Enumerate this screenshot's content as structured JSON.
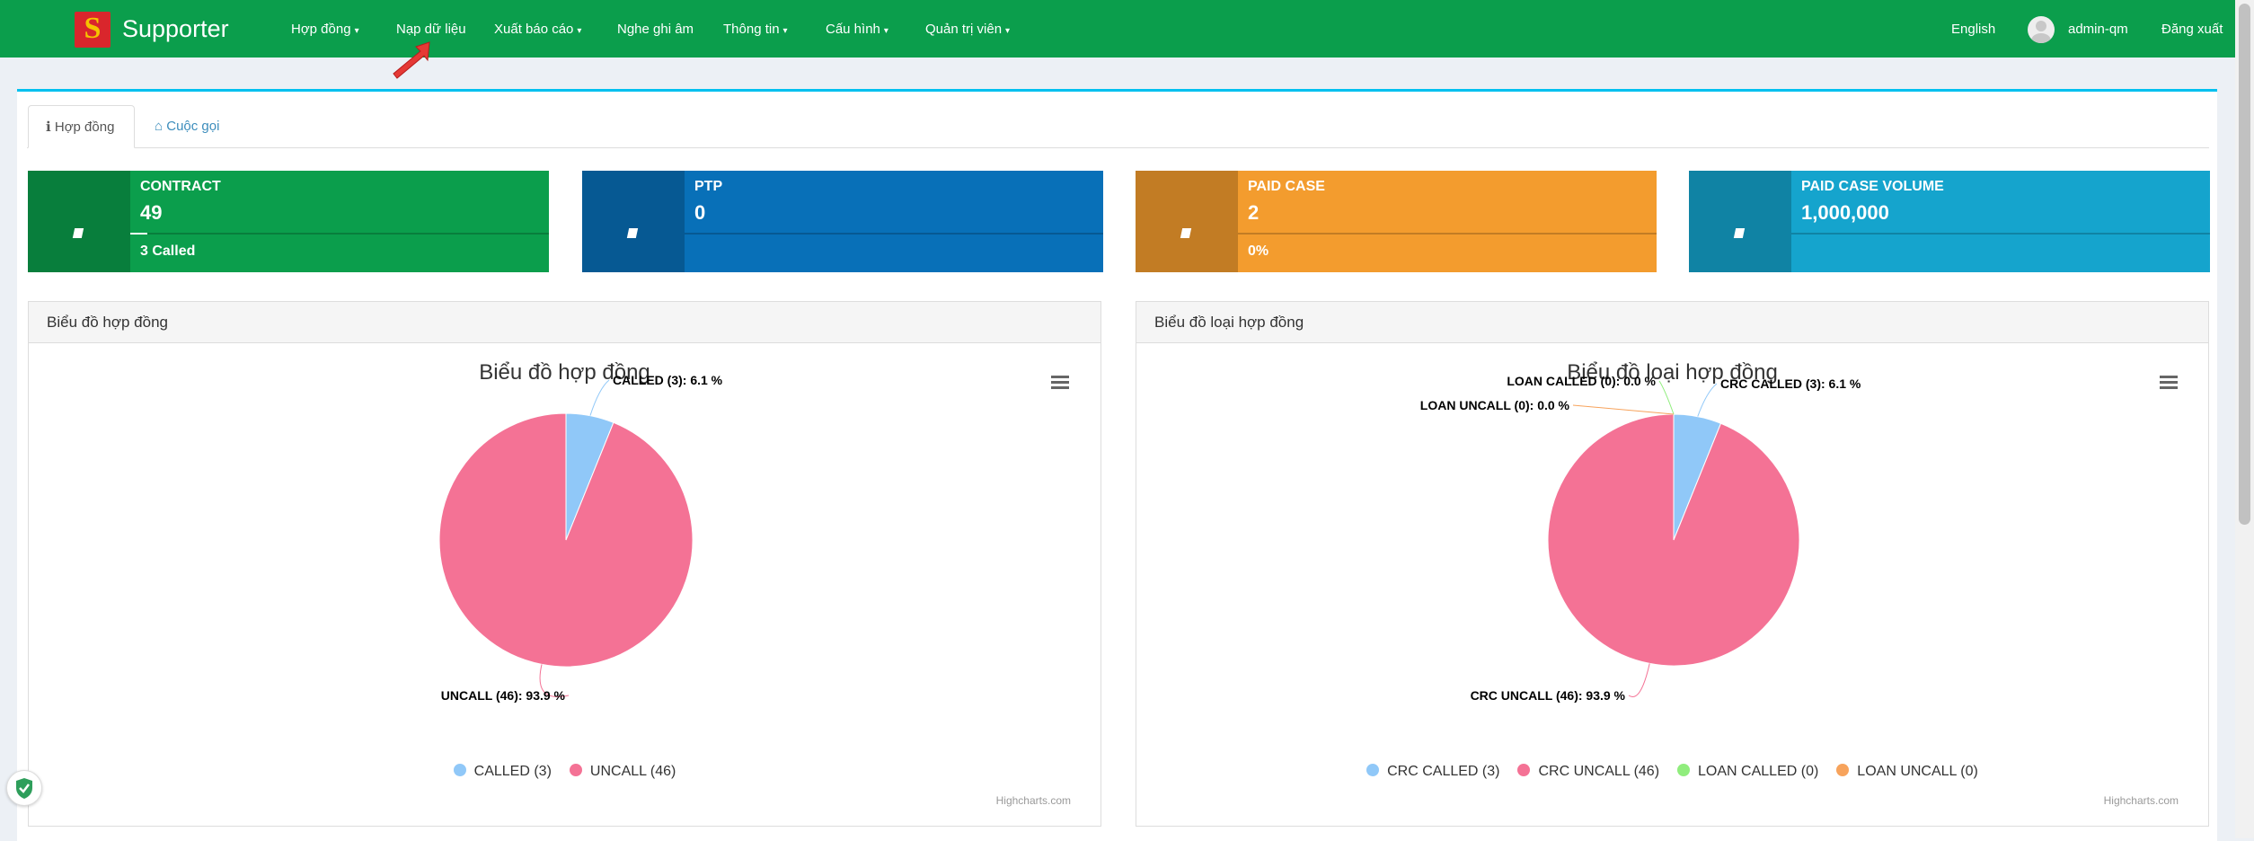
{
  "navbar": {
    "brand": "Supporter",
    "logo_letter": "S",
    "menu": [
      {
        "label": "Hợp đồng",
        "dropdown": true
      },
      {
        "label": "Nạp dữ liệu",
        "dropdown": false
      },
      {
        "label": "Xuất báo cáo",
        "dropdown": true
      },
      {
        "label": "Nghe ghi âm",
        "dropdown": false
      },
      {
        "label": "Thông tin",
        "dropdown": true
      },
      {
        "label": "Cấu hình",
        "dropdown": true
      },
      {
        "label": "Quản trị viên",
        "dropdown": true
      }
    ],
    "caret": "▾",
    "language": "English",
    "user": "admin-qm",
    "logout": "Đăng xuất"
  },
  "tabs": [
    {
      "label": "Hợp đồng",
      "icon": "info-circle-icon",
      "glyph": "ℹ",
      "active": true
    },
    {
      "label": "Cuộc gọi",
      "icon": "home-icon",
      "glyph": "⌂",
      "active": false
    }
  ],
  "info_boxes": [
    {
      "label": "CONTRACT",
      "number": "49",
      "progress": 0.04,
      "desc": "3 Called",
      "color": "#0b9e4c"
    },
    {
      "label": "PTP",
      "number": "0",
      "progress": 0,
      "desc": "",
      "color": "#0870b8"
    },
    {
      "label": "PAID CASE",
      "number": "2",
      "progress": 0,
      "desc": "0%",
      "color": "#f39c2e"
    },
    {
      "label": "PAID CASE VOLUME",
      "number": "1,000,000",
      "progress": 0,
      "desc": "",
      "color": "#15a4cd"
    }
  ],
  "panels": [
    {
      "heading": "Biểu đồ hợp đồng",
      "credits": "Highcharts.com"
    },
    {
      "heading": "Biểu đồ loại hợp đồng",
      "credits": "Highcharts.com"
    }
  ],
  "chart_data": [
    {
      "type": "pie",
      "title": "Biểu đồ hợp đồng",
      "series": [
        {
          "values": [
            {
              "name": "CALLED",
              "count": 3,
              "percent": 6.1,
              "label": "CALLED (3): 6.1 %",
              "legend": "CALLED (3)",
              "color": "#90c8f8"
            },
            {
              "name": "UNCALL",
              "count": 46,
              "percent": 93.9,
              "label": "UNCALL (46): 93.9 %",
              "legend": "UNCALL (46)",
              "color": "#f47295"
            }
          ]
        }
      ],
      "legend_position": "bottom-center"
    },
    {
      "type": "pie",
      "title": "Biểu đồ loại hợp đồng",
      "series": [
        {
          "values": [
            {
              "name": "CRC CALLED",
              "count": 3,
              "percent": 6.1,
              "label": "CRC CALLED (3): 6.1 %",
              "legend": "CRC CALLED (3)",
              "color": "#90c8f8"
            },
            {
              "name": "CRC UNCALL",
              "count": 46,
              "percent": 93.9,
              "label": "CRC UNCALL (46): 93.9 %",
              "legend": "CRC UNCALL (46)",
              "color": "#f47295"
            },
            {
              "name": "LOAN CALLED",
              "count": 0,
              "percent": 0.0,
              "label": "LOAN CALLED (0): 0.0 %",
              "legend": "LOAN CALLED (0)",
              "color": "#90ed7d"
            },
            {
              "name": "LOAN UNCALL",
              "count": 0,
              "percent": 0.0,
              "label": "LOAN UNCALL (0): 0.0 %",
              "legend": "LOAN UNCALL (0)",
              "color": "#f7a35c"
            }
          ]
        }
      ],
      "legend_position": "bottom-center"
    }
  ]
}
